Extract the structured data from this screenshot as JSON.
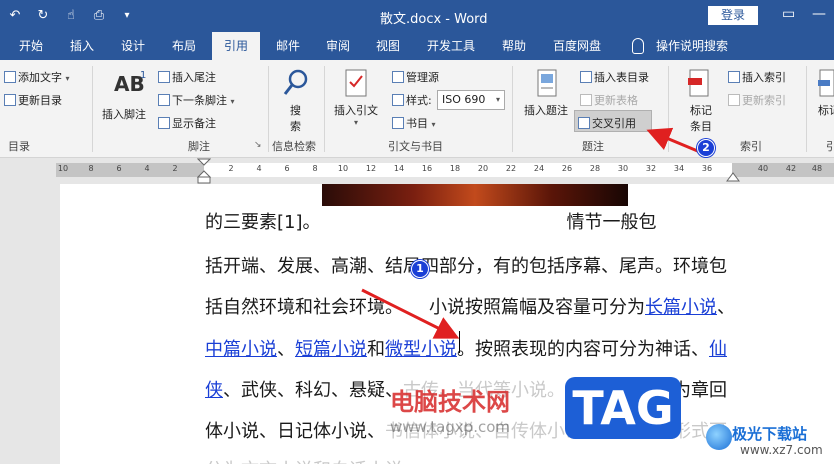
{
  "titlebar": {
    "doc_title": "散文.docx  -  Word",
    "login": "登录",
    "restore_glyph": "▭"
  },
  "tabs": [
    "开始",
    "插入",
    "设计",
    "布局",
    "引用",
    "邮件",
    "审阅",
    "视图",
    "开发工具",
    "帮助",
    "百度网盘",
    "操作说明搜索"
  ],
  "ribbon": {
    "toc": {
      "add_text": "添加文字",
      "update_toc": "更新目录",
      "group": "目录"
    },
    "footnotes": {
      "insert_footnote_1": "AB",
      "insert_footnote_sup": "1",
      "insert_footnote": "插入脚注",
      "insert_endnote": "插入尾注",
      "next_footnote": "下一条脚注",
      "show_notes": "显示备注",
      "group": "脚注"
    },
    "research": {
      "search": "搜",
      "search2": "索",
      "group": "信息检索"
    },
    "citations": {
      "insert_citation": "插入引文",
      "manage_sources": "管理源",
      "style_label": "样式:",
      "style_value": "ISO 690",
      "bibliography": "书目",
      "group": "引文与书目"
    },
    "captions": {
      "insert_caption": "插入题注",
      "insert_tof": "插入表目录",
      "update_table": "更新表格",
      "cross_ref": "交叉引用",
      "group": "题注"
    },
    "index": {
      "mark_entry_1": "标记",
      "mark_entry_2": "条目",
      "insert_index": "插入索引",
      "update_index": "更新索引",
      "group": "索引"
    },
    "toa": {
      "mark_citation_1": "标记",
      "group": "引"
    }
  },
  "ruler_ticks": [
    "10",
    "8",
    "6",
    "4",
    "2",
    "2",
    "4",
    "6",
    "8",
    "10",
    "12",
    "14",
    "16",
    "18",
    "20",
    "22",
    "24",
    "26",
    "28",
    "30",
    "32",
    "34",
    "36",
    "38",
    "40",
    "42",
    "46",
    "48"
  ],
  "document": {
    "line1_a": "的三要素[1]。",
    "line1_b": "情节一般包",
    "line2": "括开端、发展、高潮、结局四部分，有的包括序幕、尾声。环境包",
    "line3_a": "括自然环境和社会环境。",
    "line3_b": "小说按照篇幅及容量可分为",
    "line3_link": "长篇小说",
    "line3_c": "、",
    "line4_link1": "中篇小说",
    "line4_a": "、",
    "line4_link2": "短篇小说",
    "line4_b": "和",
    "line4_link3": "微型小说",
    "line4_c": "。按照表现的内容可分为神话、",
    "line4_link4": "仙",
    "line5_link": "侠",
    "line5_a": "、武侠、科幻、悬疑、",
    "line5_faint": "古传、当代等小说。按照体制可分",
    "line5_b": "为章回",
    "line6_a": "体小说、日记体小说、",
    "line6_faint": "书信体小说、自传体小说。按照语言形式可",
    "line7_faint": "分为文言小说和白话小说。"
  },
  "annotations": {
    "callout_1": "1",
    "callout_2": "2",
    "watermark_cn": "电脑技术网",
    "watermark_url": "www.tagxp.com",
    "tag": "TAG",
    "jg_name": "极光下载站",
    "jg_url": "www.xz7.com"
  },
  "colors": {
    "word_blue": "#2b579a",
    "link_blue": "#1a3fd6",
    "arrow_red": "#e02020"
  }
}
